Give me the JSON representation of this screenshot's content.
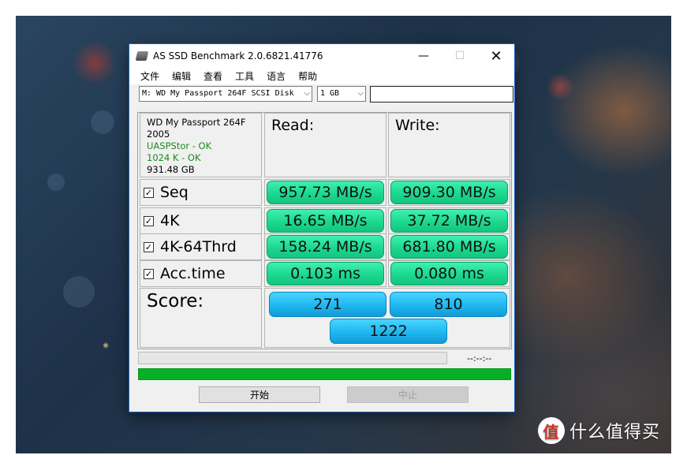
{
  "window": {
    "title": "AS SSD Benchmark 2.0.6821.41776"
  },
  "menu": [
    "文件",
    "编辑",
    "查看",
    "工具",
    "语言",
    "帮助"
  ],
  "toolbar": {
    "drive": "M: WD My Passport 264F SCSI Disk",
    "size": "1 GB"
  },
  "info": {
    "model": "WD My Passport 264F",
    "firmware": "2005",
    "driver": "UASPStor - OK",
    "alignment": "1024 K - OK",
    "capacity": "931.48 GB"
  },
  "columns": {
    "read": "Read:",
    "write": "Write:"
  },
  "rows": [
    {
      "label": "Seq",
      "checked": true,
      "read": "957.73 MB/s",
      "write": "909.30 MB/s"
    },
    {
      "label": "4K",
      "checked": true,
      "read": "16.65 MB/s",
      "write": "37.72 MB/s"
    },
    {
      "label": "4K-64Thrd",
      "checked": true,
      "read": "158.24 MB/s",
      "write": "681.80 MB/s"
    },
    {
      "label": "Acc.time",
      "checked": true,
      "read": "0.103 ms",
      "write": "0.080 ms"
    }
  ],
  "score": {
    "label": "Score:",
    "read": "271",
    "write": "810",
    "total": "1222"
  },
  "status": {
    "elapsed": "--:--:--",
    "progress_percent": 100
  },
  "buttons": {
    "start": "开始",
    "stop": "中止"
  },
  "watermark": {
    "logo": "值",
    "text": "什么值得买"
  },
  "colors": {
    "result_green": "#1cd88f",
    "score_blue": "#1fb7ef",
    "progress_green": "#06b025",
    "title_accent": "#1e62b8"
  }
}
